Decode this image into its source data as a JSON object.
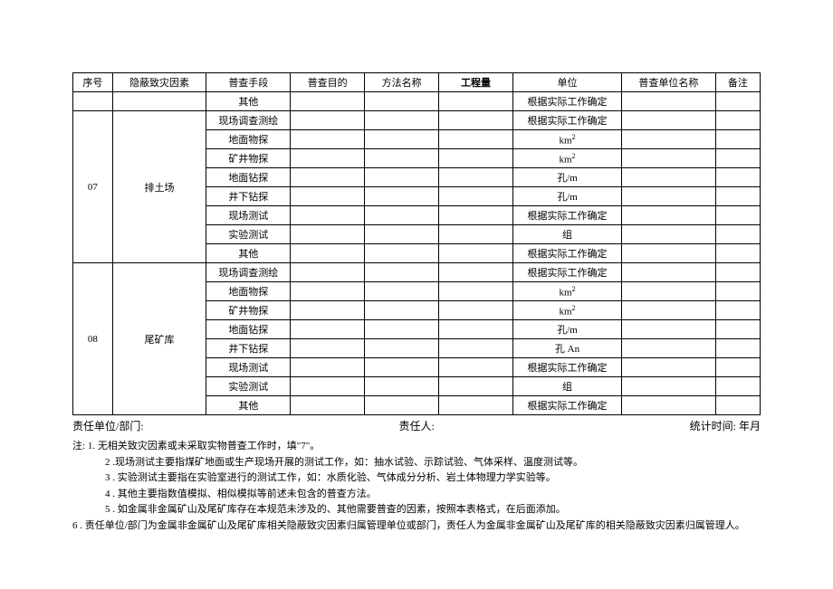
{
  "header": {
    "seq": "序号",
    "factor": "隐蔽致灾因素",
    "method": "普查手段",
    "purpose": "普查目的",
    "methodname": "方法名称",
    "gcl": "工程量",
    "unit": "单位",
    "sname": "普查单位名称",
    "note": "备注"
  },
  "rows": [
    {
      "seq": "",
      "factor": "",
      "method": "其他",
      "unit": "根据实际工作确定"
    },
    {
      "seq": "07",
      "factor": "排土场",
      "method": "现场调查测绘",
      "unit": "根据实际工作确定",
      "span": 8
    },
    {
      "method": "地面物探",
      "unit": "km²"
    },
    {
      "method": "矿井物探",
      "unit": "km²"
    },
    {
      "method": "地面钻探",
      "unit": "孔/m"
    },
    {
      "method": "井下钻探",
      "unit": "孔/m"
    },
    {
      "method": "现场测试",
      "unit": "根据实际工作确定"
    },
    {
      "method": "实验测试",
      "unit": "组"
    },
    {
      "method": "其他",
      "unit": "根据实际工作确定"
    },
    {
      "seq": "08",
      "factor": "尾矿库",
      "method": "现场调查测绘",
      "unit": "根据实际工作确定",
      "span": 8
    },
    {
      "method": "地面物探",
      "unit": "km²"
    },
    {
      "method": "矿井物探",
      "unit": "km²"
    },
    {
      "method": "地面钻探",
      "unit": "孔/m"
    },
    {
      "method": "井下钻探",
      "unit": "孔 An"
    },
    {
      "method": "现场测试",
      "unit": "根据实际工作确定"
    },
    {
      "method": "实验测试",
      "unit": "组"
    },
    {
      "method": "其他",
      "unit": "根据实际工作确定"
    }
  ],
  "footer": {
    "left": "责任单位/部门:",
    "mid": "责任人:",
    "right": "统计时间:  年月"
  },
  "notes": {
    "prefix": "注:",
    "n1": "1. 无相关致灾因素或未采取实物普查工作时，填\"7\"。",
    "n2": "2 .现场测试主要指煤矿地面或生产现场开展的测试工作，如：抽水试验、示踪试验、气体采样、温度测试等。",
    "n3": "3 . 实验测试主要指在实验室进行的测试工作，如：水质化验、气体成分分析、岩土体物理力学实验等。",
    "n4": "4 . 其他主要指数值模拟、相似模拟等前述未包含的普查方法。",
    "n5": "5 . 如金属非金属矿山及尾矿库存在本规范未涉及的、其他需要普查的因素，按照本表格式，在后面添加。",
    "n6": "6 . 责任单位/部门为金属非金属矿山及尾矿库相关隐蔽致灾因素归属管理单位或部门，责任人为金属非金属矿山及尾矿库的相关隐蔽致灾因素归属管理人。"
  }
}
